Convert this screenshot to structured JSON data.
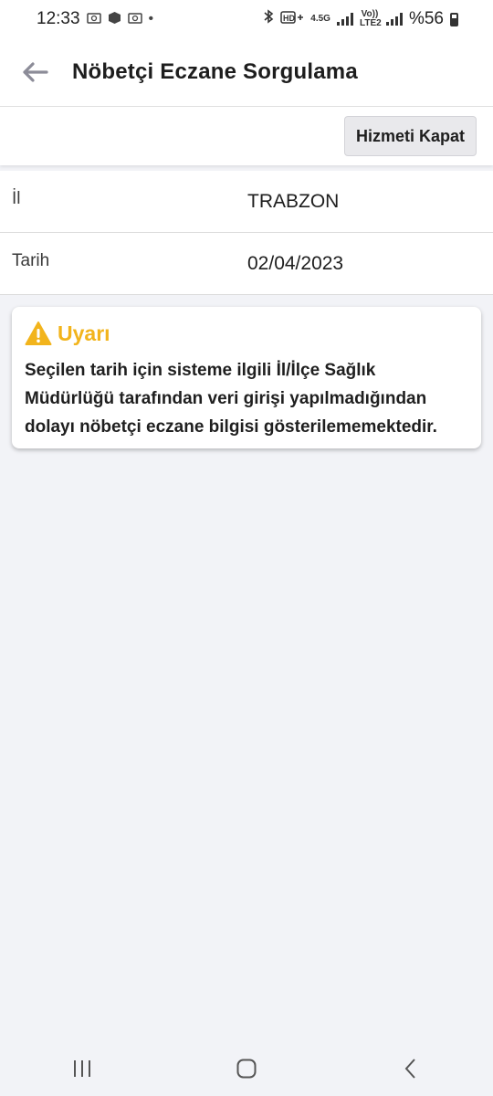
{
  "status_bar": {
    "time": "12:33",
    "battery_text": "%56",
    "network_label": "4.5G",
    "volte_label": "Vo)) LTE2",
    "left_icons": [
      "photo-icon",
      "cube-icon",
      "photo-icon",
      "dot-icon"
    ],
    "right_icons": [
      "bluetooth-icon",
      "hd-icon",
      "signal-icon",
      "signal-icon",
      "battery-icon"
    ]
  },
  "app_bar": {
    "title": "Nöbetçi Eczane Sorgulama",
    "back_icon": "arrow-left-icon"
  },
  "actions": {
    "close_service_label": "Hizmeti Kapat"
  },
  "info": {
    "rows": [
      {
        "label": "İl",
        "value": "TRABZON"
      },
      {
        "label": "Tarih",
        "value": "02/04/2023"
      }
    ]
  },
  "warning": {
    "title": "Uyarı",
    "icon": "warning-triangle-icon",
    "message": "Seçilen tarih için sisteme ilgili İl/İlçe Sağlık Müdürlüğü tarafından veri girişi yapılmadığından dolayı nöbetçi eczane bilgisi gösterilememektedir."
  },
  "nav_bar": {
    "icons": [
      "recent-apps-icon",
      "home-icon",
      "back-icon"
    ]
  },
  "colors": {
    "background": "#f2f3f7",
    "warning_accent": "#f2b41c",
    "surface": "#ffffff"
  }
}
